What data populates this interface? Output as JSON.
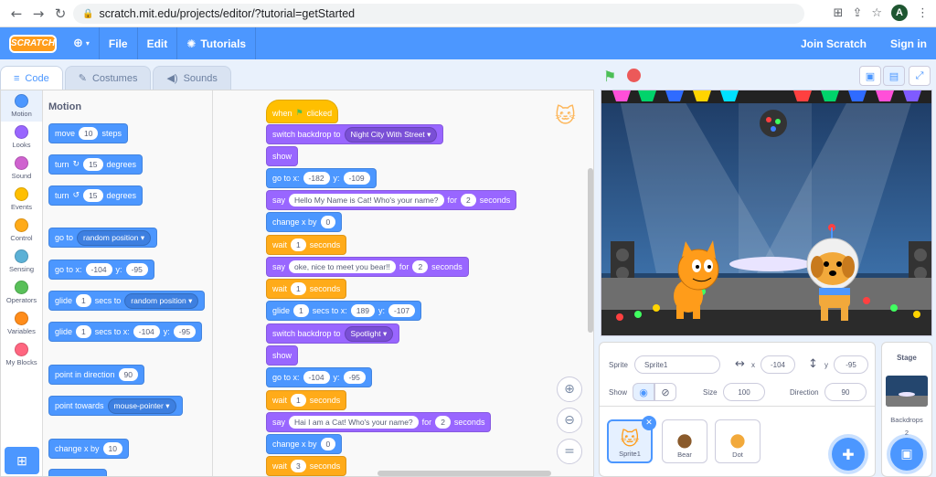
{
  "browser": {
    "url": "scratch.mit.edu/projects/editor/?tutorial=getStarted",
    "profile_initial": "A"
  },
  "menubar": {
    "logo": "SCRATCH",
    "file": "File",
    "edit": "Edit",
    "tutorials": "Tutorials",
    "join": "Join Scratch",
    "signin": "Sign in"
  },
  "tabs": {
    "code": "Code",
    "costumes": "Costumes",
    "sounds": "Sounds"
  },
  "categories": [
    {
      "label": "Motion",
      "color": "#4c97ff"
    },
    {
      "label": "Looks",
      "color": "#9966ff"
    },
    {
      "label": "Sound",
      "color": "#cf63cf"
    },
    {
      "label": "Events",
      "color": "#ffbf00"
    },
    {
      "label": "Control",
      "color": "#ffab19"
    },
    {
      "label": "Sensing",
      "color": "#5cb1d6"
    },
    {
      "label": "Operators",
      "color": "#59c059"
    },
    {
      "label": "Variables",
      "color": "#ff8c1a"
    },
    {
      "label": "My Blocks",
      "color": "#ff6680"
    }
  ],
  "palette": {
    "title": "Motion",
    "move": {
      "a": "move",
      "v": "10",
      "b": "steps"
    },
    "turn_right": {
      "a": "turn",
      "v": "15",
      "b": "degrees"
    },
    "turn_left": {
      "a": "turn",
      "v": "15",
      "b": "degrees"
    },
    "goto": {
      "a": "go to",
      "d": "random position"
    },
    "gotoxy": {
      "a": "go to x:",
      "x": "-104",
      "yl": "y:",
      "y": "-95"
    },
    "glide_to": {
      "a": "glide",
      "v": "1",
      "b": "secs to",
      "d": "random position"
    },
    "glide_xy": {
      "a": "glide",
      "v": "1",
      "b": "secs to x:",
      "x": "-104",
      "yl": "y:",
      "y": "-95"
    },
    "point_dir": {
      "a": "point in direction",
      "v": "90"
    },
    "point_towards": {
      "a": "point towards",
      "d": "mouse-pointer"
    },
    "change_x": {
      "a": "change x by",
      "v": "10"
    }
  },
  "script": {
    "when": "when",
    "clicked": "clicked",
    "switch1": {
      "a": "switch backdrop to",
      "d": "Night City With Street"
    },
    "show1": "show",
    "goto1": {
      "a": "go to x:",
      "x": "-182",
      "yl": "y:",
      "y": "-109"
    },
    "say1": {
      "a": "say",
      "t": "Hello My Name is Cat! Who's your name?",
      "f": "for",
      "v": "2",
      "s": "seconds"
    },
    "changex1": {
      "a": "change x by",
      "v": "0"
    },
    "wait1": {
      "a": "wait",
      "v": "1",
      "s": "seconds"
    },
    "say2": {
      "a": "say",
      "t": "oke, nice to meet you bear!!",
      "f": "for",
      "v": "2",
      "s": "seconds"
    },
    "wait2": {
      "a": "wait",
      "v": "1",
      "s": "seconds"
    },
    "glide1": {
      "a": "glide",
      "v": "1",
      "b": "secs to x:",
      "x": "189",
      "yl": "y:",
      "y": "-107"
    },
    "switch2": {
      "a": "switch backdrop to",
      "d": "Spotlight"
    },
    "show2": "show",
    "goto2": {
      "a": "go to x:",
      "x": "-104",
      "yl": "y:",
      "y": "-95"
    },
    "wait3": {
      "a": "wait",
      "v": "1",
      "s": "seconds"
    },
    "say3": {
      "a": "say",
      "t": "Hai I am a Cat! Who's your name?",
      "f": "for",
      "v": "2",
      "s": "seconds"
    },
    "changex2": {
      "a": "change x by",
      "v": "0"
    },
    "wait4": {
      "a": "wait",
      "v": "3",
      "s": "seconds"
    }
  },
  "sprite_info": {
    "sprite_label": "Sprite",
    "sprite_name": "Sprite1",
    "x_label": "x",
    "x": "-104",
    "y_label": "y",
    "y": "-95",
    "show_label": "Show",
    "size_label": "Size",
    "size": "100",
    "direction_label": "Direction",
    "direction": "90"
  },
  "sprites": [
    {
      "name": "Sprite1"
    },
    {
      "name": "Bear"
    },
    {
      "name": "Dot"
    }
  ],
  "stage_pane": {
    "title": "Stage",
    "backdrops_label": "Backdrops",
    "backdrops_count": "2"
  }
}
